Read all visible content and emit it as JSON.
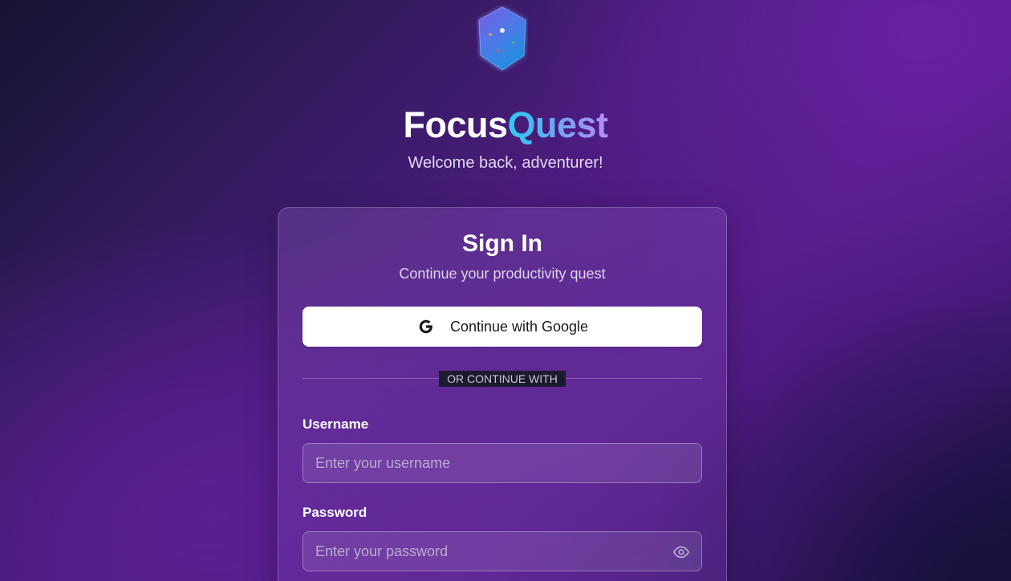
{
  "app": {
    "name_part1": "Focus",
    "name_part2": "Quest",
    "tagline": "Welcome back, adventurer!",
    "logo_icon": "crystal-shield-icon"
  },
  "signin": {
    "title": "Sign In",
    "subtitle": "Continue your productivity quest",
    "google_button_label": "Continue with Google",
    "google_icon": "google-g-icon",
    "divider_text": "OR CONTINUE WITH"
  },
  "form": {
    "username_label": "Username",
    "username_placeholder": "Enter your username",
    "username_value": "",
    "password_label": "Password",
    "password_placeholder": "Enter your password",
    "password_value": "",
    "password_toggle_icon": "eye-icon"
  },
  "colors": {
    "background_dark": "#161331",
    "background_purple": "#561c8a",
    "accent_cyan": "#2ec9ef",
    "accent_violet": "#b58af5",
    "button_bg": "#ffffff"
  }
}
